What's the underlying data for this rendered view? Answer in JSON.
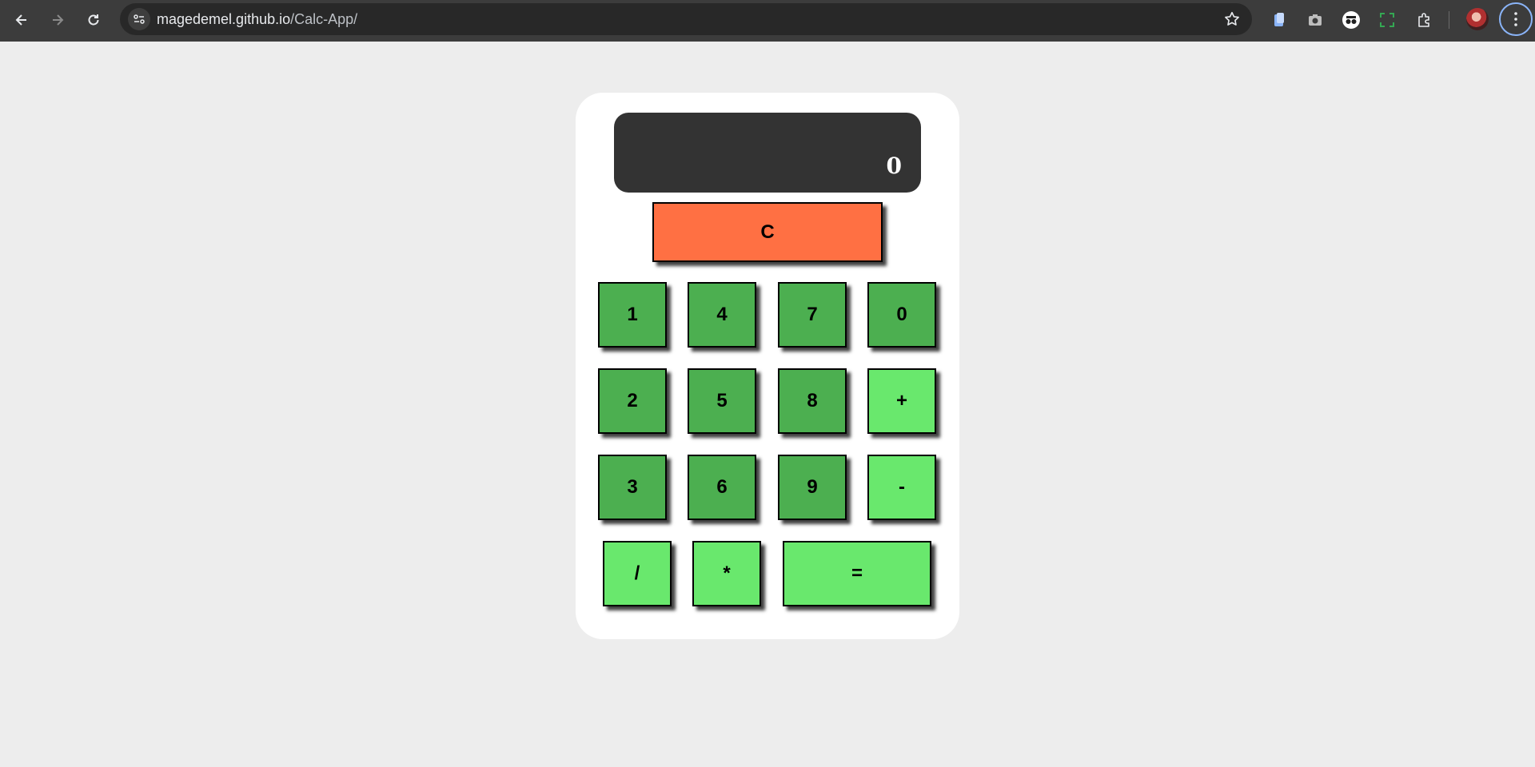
{
  "browser": {
    "url_host": "magedemel.github.io",
    "url_path": "/Calc-App/",
    "icons": [
      "back-icon",
      "forward-icon",
      "reload-icon",
      "site-info-icon",
      "bookmark-star-icon",
      "files-extension-icon",
      "camera-extension-icon",
      "incognito-extension-icon",
      "screenshot-extension-icon",
      "extensions-puzzle-icon",
      "profile-avatar",
      "menu-dots-icon"
    ]
  },
  "calculator": {
    "display": "0",
    "clear_label": "C",
    "keys": {
      "k1": "1",
      "k4": "4",
      "k7": "7",
      "k0": "0",
      "k2": "2",
      "k5": "5",
      "k8": "8",
      "plus": "+",
      "k3": "3",
      "k6": "6",
      "k9": "9",
      "minus": "-",
      "divide": "/",
      "multiply": "*",
      "equals": "="
    }
  },
  "colors": {
    "page_bg": "#ededed",
    "display_bg": "#333333",
    "clear_key": "#ff7043",
    "number_key": "#4caf50",
    "operator_key": "#69e86d"
  }
}
